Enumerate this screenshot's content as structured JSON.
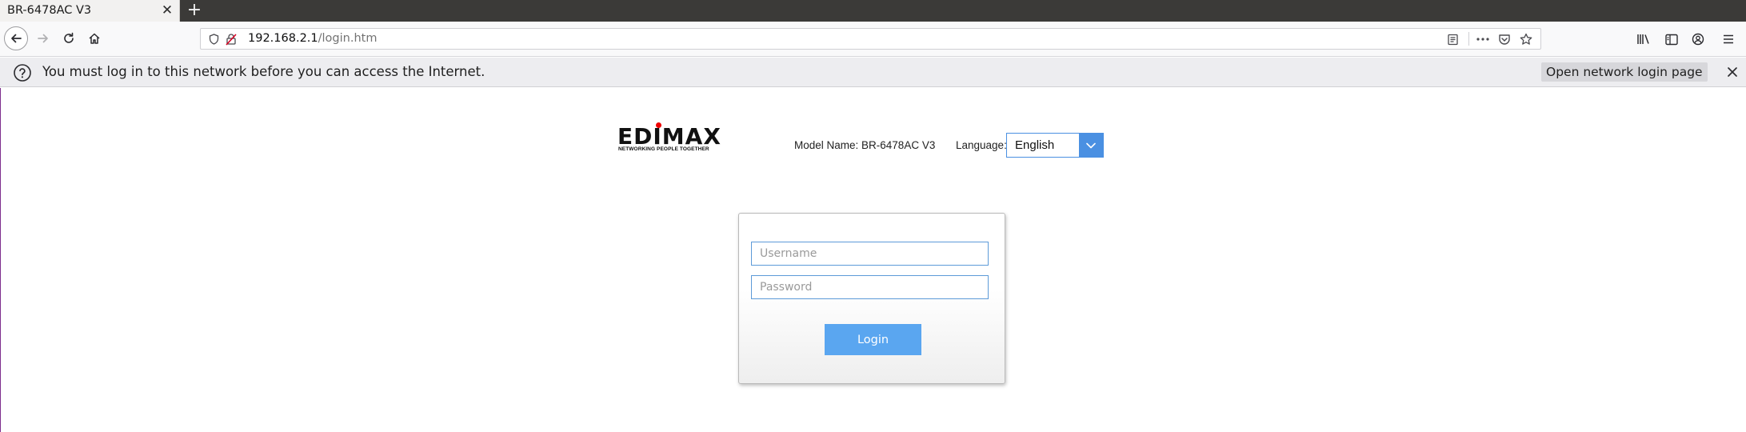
{
  "browser": {
    "tab": {
      "title": "BR-6478AC V3",
      "close_icon": "close-icon"
    },
    "new_tab_icon": "plus-icon",
    "nav": {
      "back_icon": "arrow-left-icon",
      "forward_icon": "arrow-right-icon",
      "reload_icon": "reload-icon",
      "home_icon": "home-icon"
    },
    "url": {
      "host": "192.168.2.1",
      "path": "/login.htm",
      "security_icon": "shield-icon",
      "insecure_icon": "lock-insecure-icon",
      "reader_icon": "reader-view-icon",
      "more_icon": "ellipsis-icon",
      "pocket_icon": "pocket-icon",
      "bookmark_icon": "star-icon"
    },
    "toolbar_icons": [
      "library-icon",
      "sidebar-icon",
      "account-icon",
      "menu-icon"
    ]
  },
  "notification": {
    "icon": "question-icon",
    "message": "You must log in to this network before you can access the Internet.",
    "button_label": "Open network login page",
    "close_icon": "close-icon"
  },
  "router": {
    "logo_text": "EDIMAX",
    "logo_tagline": "NETWORKING PEOPLE TOGETHER",
    "model_label": "Model Name: BR-6478AC V3",
    "language_label": "Language:",
    "language_value": "English",
    "colors": {
      "accent": "#4a90e2",
      "button": "#5aa6f0",
      "logo_dot": "#e00000"
    }
  },
  "login": {
    "username_placeholder": "Username",
    "password_placeholder": "Password",
    "button_label": "Login"
  }
}
